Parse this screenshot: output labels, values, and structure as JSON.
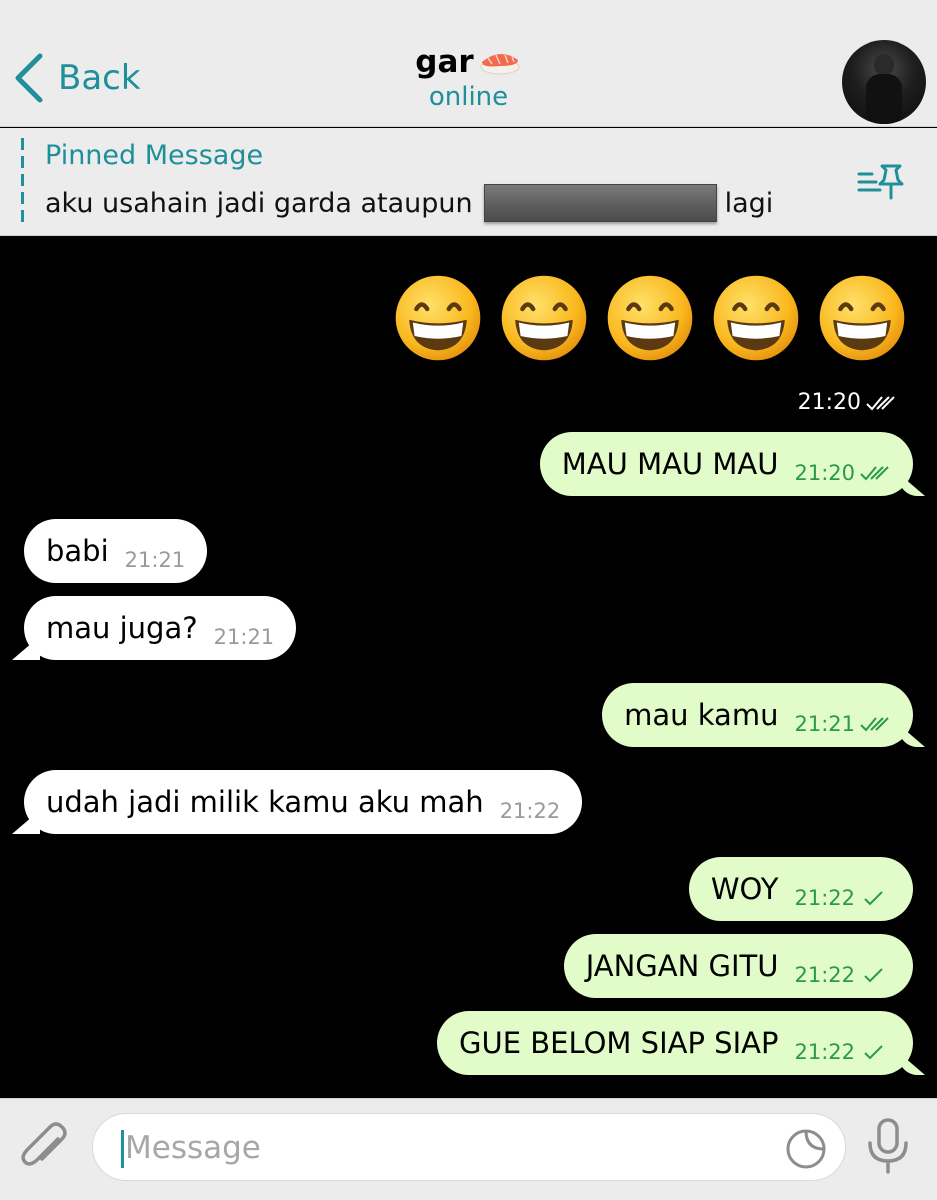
{
  "header": {
    "back_label": "Back",
    "contact_name": "gar",
    "contact_emoji": "sushi",
    "status": "online"
  },
  "pinned": {
    "title": "Pinned Message",
    "text_before": "aku usahain jadi garda ataupun",
    "text_after": "lagi"
  },
  "messages": [
    {
      "dir": "out",
      "type": "emoji",
      "emoji": "grinning-face-with-smiling-eyes",
      "count": 5,
      "time": "21:20",
      "status": "read"
    },
    {
      "dir": "out",
      "text": "MAU MAU MAU",
      "time": "21:20",
      "status": "read"
    },
    {
      "dir": "in",
      "text": "babi",
      "time": "21:21"
    },
    {
      "dir": "in",
      "text": "mau juga?",
      "time": "21:21"
    },
    {
      "dir": "out",
      "text": "mau kamu",
      "time": "21:21",
      "status": "read"
    },
    {
      "dir": "in",
      "text": "udah jadi milik kamu aku mah",
      "time": "21:22"
    },
    {
      "dir": "out",
      "text": "WOY",
      "time": "21:22",
      "status": "delivered"
    },
    {
      "dir": "out",
      "text": "JANGAN GITU",
      "time": "21:22",
      "status": "delivered"
    },
    {
      "dir": "out",
      "text": "GUE BELOM SIAP SIAP",
      "time": "21:22",
      "status": "delivered"
    }
  ],
  "composer": {
    "placeholder": "Message",
    "attach_icon": "paperclip-icon",
    "sticker_icon": "sticker-icon",
    "mic_icon": "microphone-icon"
  },
  "colors": {
    "accent": "#1f8f9a",
    "outgoing_bubble": "#e2fcc9",
    "incoming_bubble": "#ffffff",
    "outgoing_time": "#2b9a47",
    "chat_background": "#000000",
    "bar_background": "#ececec"
  }
}
